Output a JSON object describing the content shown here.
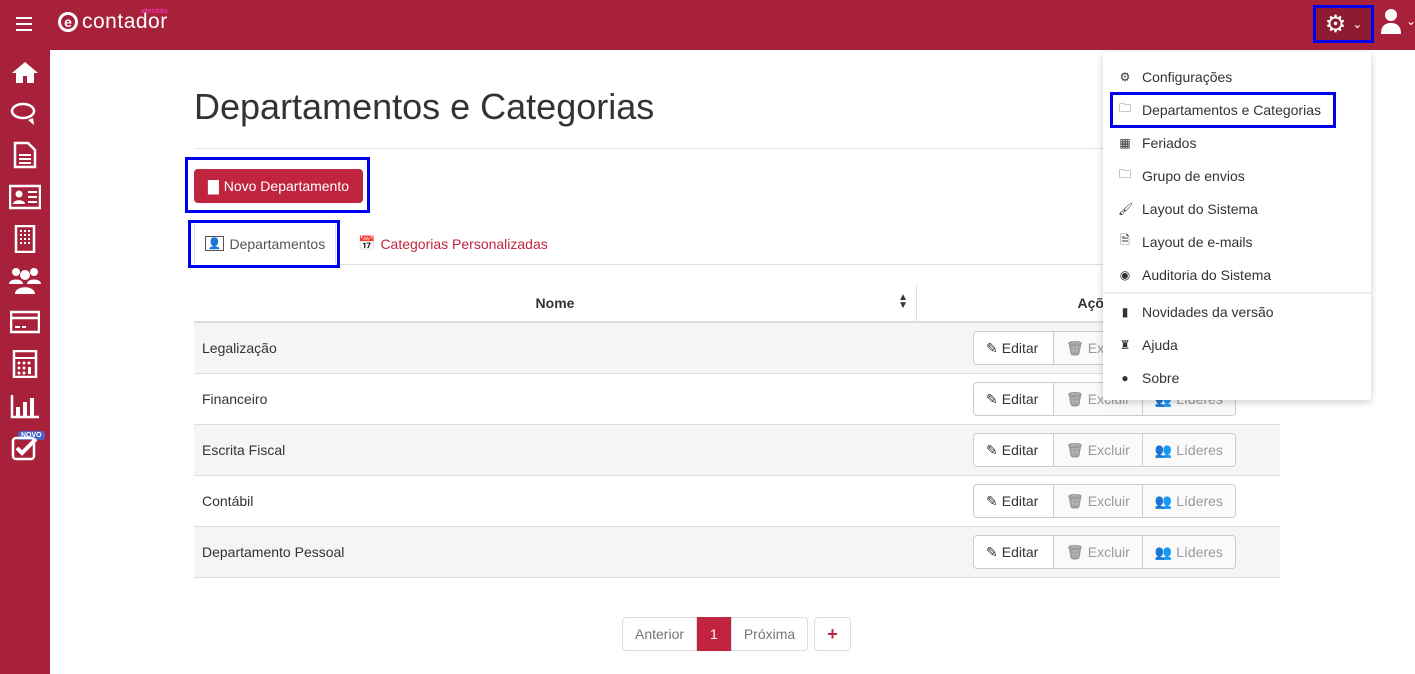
{
  "header": {
    "logo_text": "contador",
    "logo_small": "alterdata",
    "logo_letter": "e"
  },
  "sidebar": {
    "items": [
      "home",
      "chat",
      "document",
      "contact-card",
      "building",
      "users",
      "credit-card",
      "calculator",
      "reports",
      "tasks"
    ],
    "badge": "NOVO"
  },
  "page": {
    "title": "Departamentos e Categorias",
    "new_button": "Novo Departamento"
  },
  "tabs": [
    {
      "label": "Departamentos"
    },
    {
      "label": "Categorias Personalizadas"
    }
  ],
  "table": {
    "headers": [
      "Nome",
      "Ações"
    ],
    "rows": [
      {
        "name": "Legalização"
      },
      {
        "name": "Financeiro"
      },
      {
        "name": "Escrita Fiscal"
      },
      {
        "name": "Contábil"
      },
      {
        "name": "Departamento Pessoal"
      }
    ],
    "actions": {
      "edit": "Editar",
      "delete": "Excluir",
      "leaders": "Líderes"
    }
  },
  "pagination": {
    "prev": "Anterior",
    "current": "1",
    "next": "Próxima",
    "add": "+"
  },
  "menu": {
    "items": [
      "Configurações",
      "Departamentos e Categorias",
      "Feriados",
      "Grupo de envios",
      "Layout do Sistema",
      "Layout de e-mails",
      "Auditoria do Sistema",
      "Novidades da versão",
      "Ajuda",
      "Sobre"
    ]
  },
  "colors": {
    "brand": "#a8213a",
    "accent": "#c0243f",
    "highlight": "#0000ee"
  }
}
